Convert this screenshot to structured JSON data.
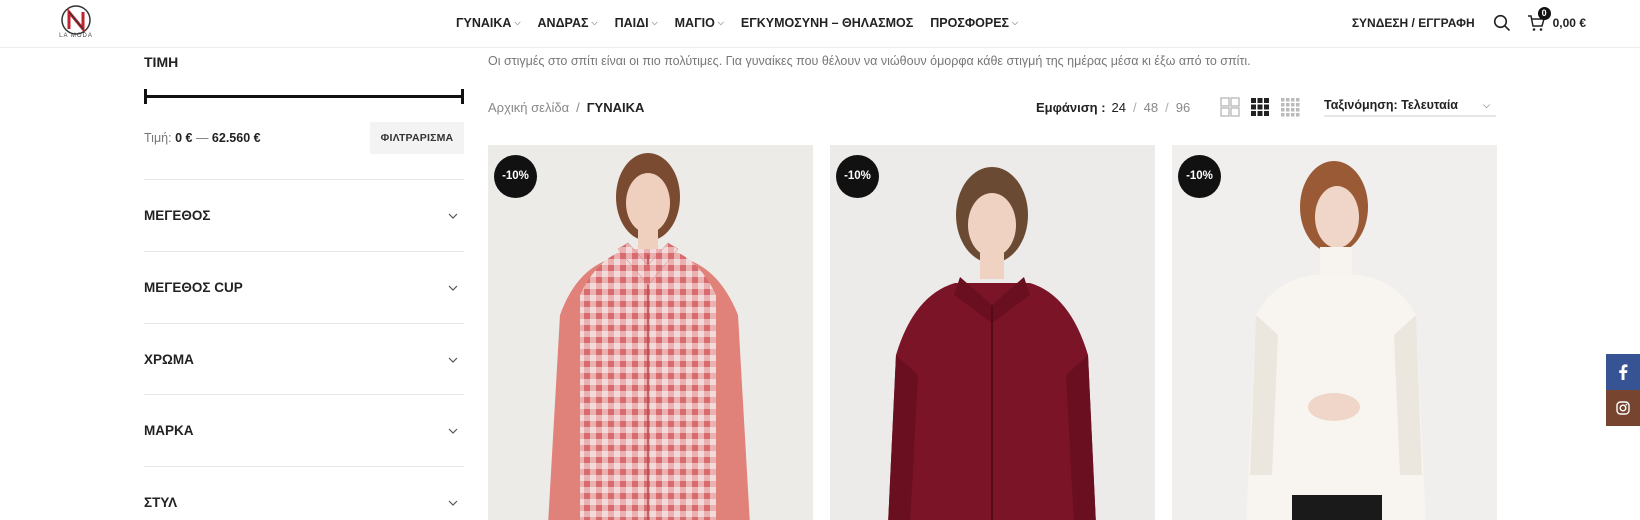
{
  "brand": {
    "logo_text": "LA MODA",
    "accent": "#c0232c"
  },
  "nav": {
    "items": [
      {
        "label": "ΓΥΝΑΙΚΑ",
        "has_dropdown": true
      },
      {
        "label": "ΑΝΔΡΑΣ",
        "has_dropdown": true
      },
      {
        "label": "ΠΑΙΔΙ",
        "has_dropdown": true
      },
      {
        "label": "ΜΑΓΙΟ",
        "has_dropdown": true
      },
      {
        "label": "ΕΓΚΥΜΟΣΥΝΗ – ΘΗΛΑΣΜΟΣ",
        "has_dropdown": false
      },
      {
        "label": "ΠΡΟΣΦΟΡΕΣ",
        "has_dropdown": true
      }
    ],
    "login_label": "ΣΥΝΔΕΣΗ / ΕΓΓΡΑΦΗ",
    "cart_count": "0",
    "cart_total": "0,00 €"
  },
  "sidebar": {
    "price_title": "ΤΙΜΗ",
    "price_label": "Τιμή:",
    "price_min": "0 €",
    "price_dash": "—",
    "price_max": "62.560 €",
    "filter_button": "ΦΙΛΤΡΑΡΙΣΜΑ",
    "facets": [
      "ΜΕΓΕΘΟΣ",
      "ΜΕΓΕΘΟΣ CUP",
      "ΧΡΩΜΑ",
      "ΜΑΡΚΑ",
      "ΣΤΥΛ"
    ]
  },
  "main": {
    "intro": "Οι στιγμές στο σπίτι είναι οι πιο πολύτιμες. Για γυναίκες που θέλουν να νιώθουν όμορφα κάθε στιγμή της ημέρας  μέσα κι έξω από το σπίτι.",
    "breadcrumb": {
      "home": "Αρχική σελίδα",
      "sep": "/",
      "current": "ΓΥΝΑΙΚΑ"
    },
    "show": {
      "label": "Εμφάνιση :",
      "options": [
        "24",
        "48",
        "96"
      ],
      "sep": "/",
      "selected": "24"
    },
    "sort_label": "Ταξινόμηση: Τελευταία",
    "products": [
      {
        "badge": "-10%",
        "image": "woman-pink-gingham-vest-pajamas"
      },
      {
        "badge": "-10%",
        "image": "woman-burgundy-fleece-zip-jacket"
      },
      {
        "badge": "-10%",
        "image": "woman-white-turtleneck-top"
      }
    ]
  },
  "social": [
    "facebook-icon",
    "instagram-icon"
  ]
}
